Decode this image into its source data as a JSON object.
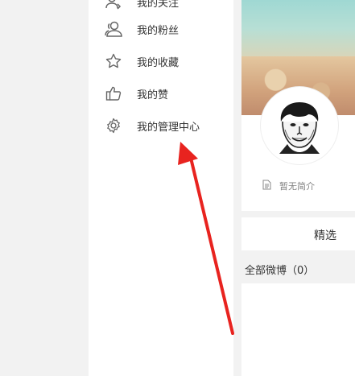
{
  "sidebar": {
    "items": [
      {
        "label": "我的关注",
        "icon": "user-plus-icon"
      },
      {
        "label": "我的粉丝",
        "icon": "users-icon"
      },
      {
        "label": "我的收藏",
        "icon": "star-icon"
      },
      {
        "label": "我的赞",
        "icon": "thumbs-up-icon"
      },
      {
        "label": "我的管理中心",
        "icon": "gear-icon"
      }
    ]
  },
  "profile": {
    "bio": "暂无简介"
  },
  "tabs": {
    "featured": "精选"
  },
  "feed": {
    "title": "全部微博（0）"
  },
  "colors": {
    "annotation_arrow": "#e8231f",
    "icon": "#666666",
    "text": "#333333",
    "muted": "#808080"
  }
}
